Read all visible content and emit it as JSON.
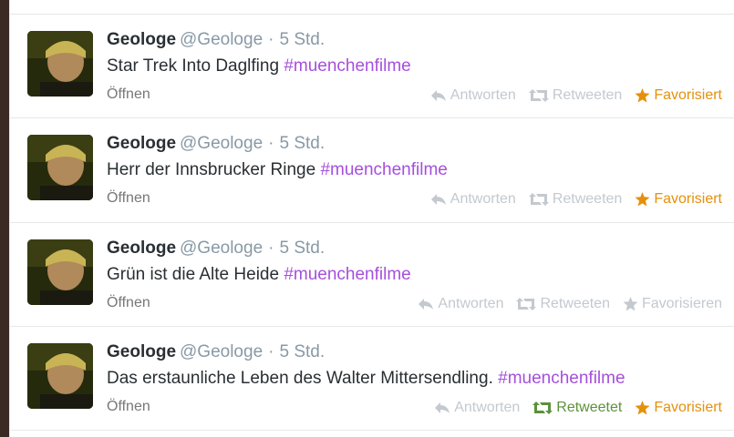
{
  "tweets": [
    {
      "fullname": "Geologe",
      "screen_name": "@Geologe",
      "separator": "·",
      "time": "5 Std.",
      "text": "Star Trek Into Daglfing",
      "hashtag": "#muenchenfilme",
      "open": "Öffnen",
      "reply": "Antworten",
      "retweet": "Retweeten",
      "favorite": "Favorisiert",
      "retweeted": false,
      "favorited": true
    },
    {
      "fullname": "Geologe",
      "screen_name": "@Geologe",
      "separator": "·",
      "time": "5 Std.",
      "text": "Herr der Innsbrucker Ringe",
      "hashtag": "#muenchenfilme",
      "open": "Öffnen",
      "reply": "Antworten",
      "retweet": "Retweeten",
      "favorite": "Favorisiert",
      "retweeted": false,
      "favorited": true
    },
    {
      "fullname": "Geologe",
      "screen_name": "@Geologe",
      "separator": "·",
      "time": "5 Std.",
      "text": "Grün ist die Alte Heide",
      "hashtag": "#muenchenfilme",
      "open": "Öffnen",
      "reply": "Antworten",
      "retweet": "Retweeten",
      "favorite": "Favorisieren",
      "retweeted": false,
      "favorited": false
    },
    {
      "fullname": "Geologe",
      "screen_name": "@Geologe",
      "separator": "·",
      "time": "5 Std.",
      "text": "Das erstaunliche Leben des Walter Mittersendling.",
      "hashtag": "#muenchenfilme",
      "open": "Öffnen",
      "reply": "Antworten",
      "retweet": "Retweetet",
      "favorite": "Favorisiert",
      "retweeted": true,
      "favorited": true
    }
  ],
  "colors": {
    "hashtag": "#a64fdc",
    "favorited": "#e5900c",
    "retweeted": "#5c913b",
    "inactive_action": "#c3c9cf"
  },
  "icons": {
    "reply": "reply-arrow-icon",
    "retweet": "retweet-arrows-icon",
    "favorite": "star-icon"
  }
}
